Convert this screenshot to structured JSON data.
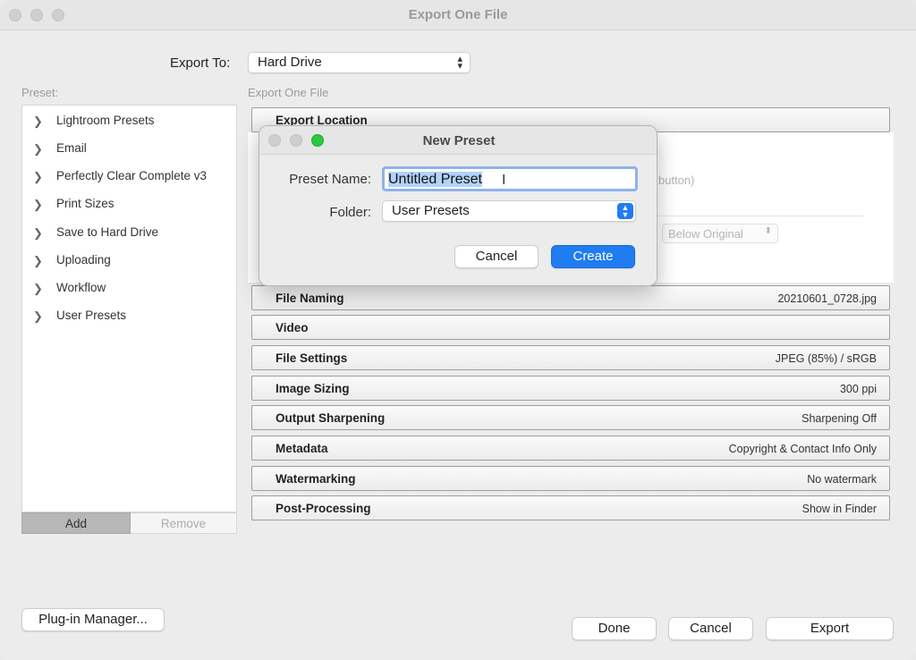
{
  "window": {
    "title": "Export One File",
    "export_to_label": "Export To:",
    "export_to_value": "Hard Drive",
    "preset_label": "Preset:",
    "export_one_file_label": "Export One File"
  },
  "presets": [
    {
      "label": "Lightroom Presets"
    },
    {
      "label": "Email"
    },
    {
      "label": "Perfectly Clear Complete v3"
    },
    {
      "label": "Print Sizes"
    },
    {
      "label": "Save to Hard Drive"
    },
    {
      "label": "Uploading"
    },
    {
      "label": "Workflow"
    },
    {
      "label": "User Presets"
    }
  ],
  "preset_buttons": {
    "add": "Add",
    "remove": "Remove"
  },
  "sections": [
    {
      "name": "Export Location",
      "value": ""
    },
    {
      "name": "File Naming",
      "value": "20210601_0728.jpg"
    },
    {
      "name": "Video",
      "value": ""
    },
    {
      "name": "File Settings",
      "value": "JPEG (85%) / sRGB"
    },
    {
      "name": "Image Sizing",
      "value": "300 ppi"
    },
    {
      "name": "Output Sharpening",
      "value": "Sharpening Off"
    },
    {
      "name": "Metadata",
      "value": "Copyright & Contact Info Only"
    },
    {
      "name": "Watermarking",
      "value": "No watermark"
    },
    {
      "name": "Post-Processing",
      "value": "Show in Finder"
    }
  ],
  "background_hints": {
    "button_hint": "button)",
    "below_original": "Below Original"
  },
  "footer": {
    "plugin_manager": "Plug-in Manager...",
    "done": "Done",
    "cancel": "Cancel",
    "export": "Export"
  },
  "dialog": {
    "title": "New Preset",
    "preset_name_label": "Preset Name:",
    "preset_name_value": "Untitled Preset",
    "folder_label": "Folder:",
    "folder_value": "User Presets",
    "cancel": "Cancel",
    "create": "Create",
    "accent_color": "#1f7cf1"
  }
}
